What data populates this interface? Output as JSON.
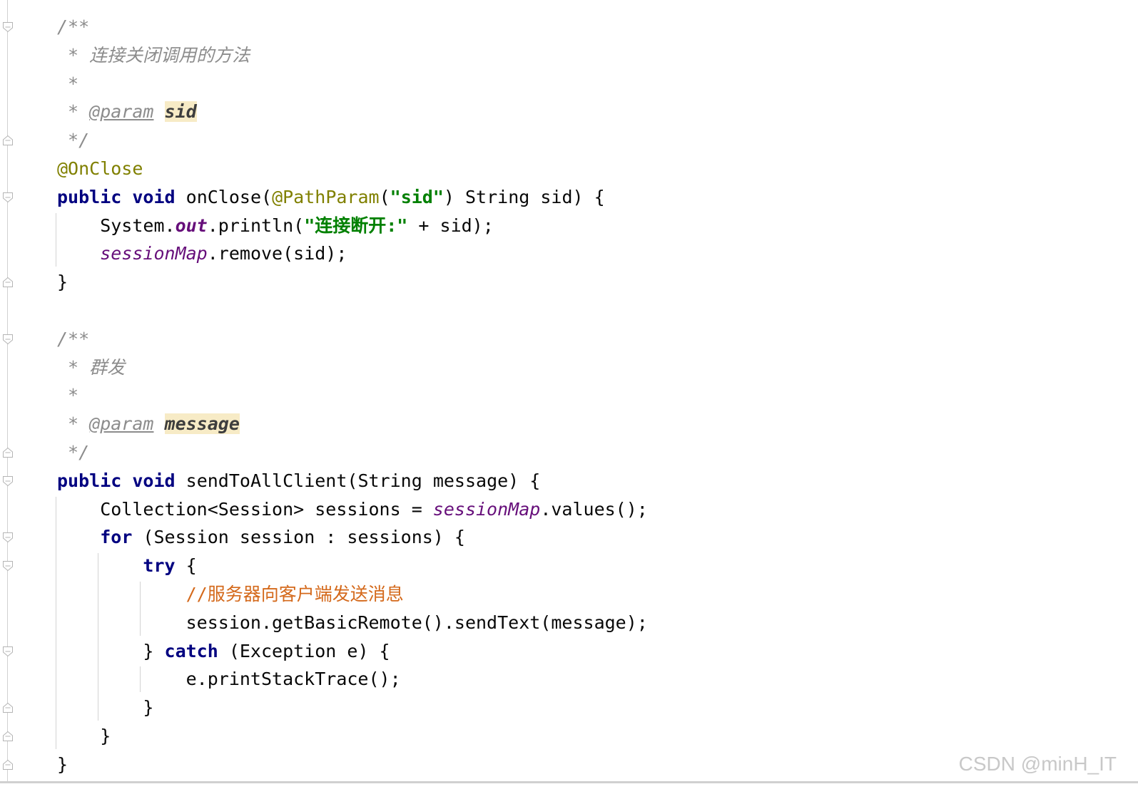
{
  "editor": {
    "lines": [
      {
        "id": "l1",
        "tokens": [
          {
            "t": "/**",
            "c": "c-doc"
          }
        ]
      },
      {
        "id": "l2",
        "tokens": [
          {
            "t": " * ",
            "c": "c-doc"
          },
          {
            "t": "连接关闭调用的方法",
            "c": "c-doc-cn"
          }
        ]
      },
      {
        "id": "l3",
        "tokens": [
          {
            "t": " *",
            "c": "c-doc"
          }
        ]
      },
      {
        "id": "l4",
        "tokens": [
          {
            "t": " * ",
            "c": "c-doc"
          },
          {
            "t": "@param",
            "c": "c-tag"
          },
          {
            "t": " ",
            "c": "c-doc"
          },
          {
            "t": "sid",
            "c": "c-param"
          }
        ]
      },
      {
        "id": "l5",
        "tokens": [
          {
            "t": " */",
            "c": "c-doc"
          }
        ]
      },
      {
        "id": "l6",
        "tokens": [
          {
            "t": "@OnClose",
            "c": "c-anno"
          }
        ]
      },
      {
        "id": "l7",
        "tokens": [
          {
            "t": "public",
            "c": "c-kw"
          },
          {
            "t": " ",
            "c": "c-plain"
          },
          {
            "t": "void",
            "c": "c-kw"
          },
          {
            "t": " onClose(",
            "c": "c-plain"
          },
          {
            "t": "@PathParam",
            "c": "c-anno"
          },
          {
            "t": "(",
            "c": "c-plain"
          },
          {
            "t": "\"sid\"",
            "c": "c-str"
          },
          {
            "t": ") String sid) {",
            "c": "c-plain"
          }
        ]
      },
      {
        "id": "l8",
        "tokens": [
          {
            "t": "    System.",
            "c": "c-plain"
          },
          {
            "t": "out",
            "c": "c-static"
          },
          {
            "t": ".println(",
            "c": "c-plain"
          },
          {
            "t": "\"连接断开:\"",
            "c": "c-str"
          },
          {
            "t": " + sid);",
            "c": "c-plain"
          }
        ]
      },
      {
        "id": "l9",
        "tokens": [
          {
            "t": "    ",
            "c": "c-plain"
          },
          {
            "t": "sessionMap",
            "c": "c-field"
          },
          {
            "t": ".remove(sid);",
            "c": "c-plain"
          }
        ]
      },
      {
        "id": "l10",
        "tokens": [
          {
            "t": "}",
            "c": "c-plain"
          }
        ]
      },
      {
        "id": "l11",
        "tokens": []
      },
      {
        "id": "l12",
        "tokens": [
          {
            "t": "/**",
            "c": "c-doc"
          }
        ]
      },
      {
        "id": "l13",
        "tokens": [
          {
            "t": " * ",
            "c": "c-doc"
          },
          {
            "t": "群发",
            "c": "c-doc-cn"
          }
        ]
      },
      {
        "id": "l14",
        "tokens": [
          {
            "t": " *",
            "c": "c-doc"
          }
        ]
      },
      {
        "id": "l15",
        "tokens": [
          {
            "t": " * ",
            "c": "c-doc"
          },
          {
            "t": "@param",
            "c": "c-tag"
          },
          {
            "t": " ",
            "c": "c-doc"
          },
          {
            "t": "message",
            "c": "c-param"
          }
        ]
      },
      {
        "id": "l16",
        "tokens": [
          {
            "t": " */",
            "c": "c-doc"
          }
        ]
      },
      {
        "id": "l17",
        "tokens": [
          {
            "t": "public",
            "c": "c-kw"
          },
          {
            "t": " ",
            "c": "c-plain"
          },
          {
            "t": "void",
            "c": "c-kw"
          },
          {
            "t": " sendToAllClient(String message) {",
            "c": "c-plain"
          }
        ]
      },
      {
        "id": "l18",
        "tokens": [
          {
            "t": "    Collection<Session> sessions = ",
            "c": "c-plain"
          },
          {
            "t": "sessionMap",
            "c": "c-field"
          },
          {
            "t": ".values();",
            "c": "c-plain"
          }
        ]
      },
      {
        "id": "l19",
        "tokens": [
          {
            "t": "    ",
            "c": "c-plain"
          },
          {
            "t": "for",
            "c": "c-kw"
          },
          {
            "t": " (Session session : sessions) {",
            "c": "c-plain"
          }
        ]
      },
      {
        "id": "l20",
        "tokens": [
          {
            "t": "        ",
            "c": "c-plain"
          },
          {
            "t": "try",
            "c": "c-kw"
          },
          {
            "t": " {",
            "c": "c-plain"
          }
        ]
      },
      {
        "id": "l21",
        "tokens": [
          {
            "t": "            ",
            "c": "c-plain"
          },
          {
            "t": "//",
            "c": "c-comment-slash"
          },
          {
            "t": "服务器向客户端发送消息",
            "c": "c-comment"
          }
        ]
      },
      {
        "id": "l22",
        "tokens": [
          {
            "t": "            session.getBasicRemote().sendText(message);",
            "c": "c-plain"
          }
        ]
      },
      {
        "id": "l23",
        "tokens": [
          {
            "t": "        } ",
            "c": "c-plain"
          },
          {
            "t": "catch",
            "c": "c-kw"
          },
          {
            "t": " (Exception e) {",
            "c": "c-plain"
          }
        ]
      },
      {
        "id": "l24",
        "tokens": [
          {
            "t": "            e.printStackTrace();",
            "c": "c-plain"
          }
        ]
      },
      {
        "id": "l25",
        "tokens": [
          {
            "t": "        }",
            "c": "c-plain"
          }
        ]
      },
      {
        "id": "l26",
        "tokens": [
          {
            "t": "    }",
            "c": "c-plain"
          }
        ]
      },
      {
        "id": "l27",
        "tokens": [
          {
            "t": "}",
            "c": "c-plain"
          }
        ]
      }
    ]
  },
  "watermark": "CSDN @minH_IT"
}
